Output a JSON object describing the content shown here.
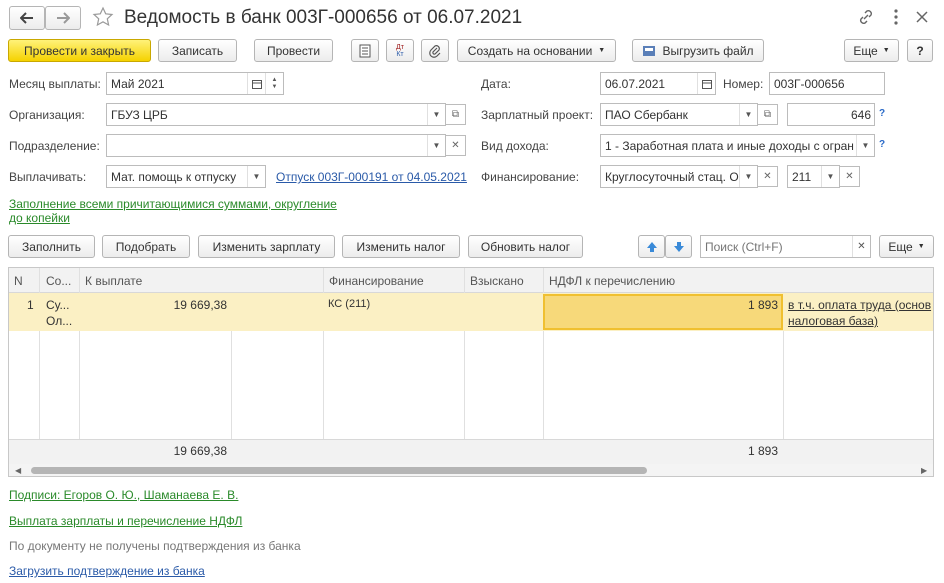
{
  "header": {
    "title": "Ведомость в банк 003Г-000656 от 06.07.2021"
  },
  "toolbar": {
    "post_close": "Провести и закрыть",
    "save": "Записать",
    "post": "Провести",
    "create_based": "Создать на основании",
    "export_file": "Выгрузить файл",
    "more": "Еще",
    "help": "?"
  },
  "form": {
    "month_label": "Месяц выплаты:",
    "month_value": "Май 2021",
    "date_label": "Дата:",
    "date_value": "06.07.2021",
    "number_label": "Номер:",
    "number_value": "003Г-000656",
    "org_label": "Организация:",
    "org_value": "ГБУЗ ЦРБ",
    "salary_project_label": "Зарплатный проект:",
    "salary_project_value": "ПАО Сбербанк",
    "salary_project_code": "646",
    "dept_label": "Подразделение:",
    "dept_value": "",
    "income_type_label": "Вид дохода:",
    "income_type_value": "1 - Заработная плата и иные доходы с огран",
    "pay_label": "Выплачивать:",
    "pay_value": "Мат. помощь к отпуску",
    "vacation_link": "Отпуск 003Г-000191 от 04.05.2021",
    "financing_label": "Финансирование:",
    "financing_value": "Круглосуточный  стац. О",
    "financing_code": "211",
    "fill_link_1": "Заполнение всеми причитающимися суммами, округление",
    "fill_link_2": "до копейки",
    "qmark": "?"
  },
  "table_toolbar": {
    "fill": "Заполнить",
    "pick": "Подобрать",
    "change_salary": "Изменить зарплату",
    "change_tax": "Изменить налог",
    "update_tax": "Обновить налог",
    "search_placeholder": "Поиск (Ctrl+F)",
    "more": "Еще"
  },
  "table": {
    "columns": [
      "N",
      "Со...",
      "К выплате",
      "Финансирование",
      "Взыскано",
      "НДФЛ к перечислению"
    ],
    "row": {
      "n": "1",
      "co_1": "Су...",
      "co_2": "Ол...",
      "amount": "19 669,38",
      "financing": "КС (211)",
      "collected": "",
      "ndfl": "1 893",
      "note_1": "в т.ч. оплата труда (основ",
      "note_2": "налоговая база)"
    },
    "footer": {
      "amount": "19 669,38",
      "ndfl": "1 893"
    }
  },
  "bottom": {
    "signatures": "Подписи: Егоров О. Ю., Шаманаева Е. В.",
    "payout": "Выплата зарплаты и перечисление НДФЛ",
    "status": "По документу не получены подтверждения из банка",
    "load_confirm": "Загрузить подтверждение из банка"
  }
}
